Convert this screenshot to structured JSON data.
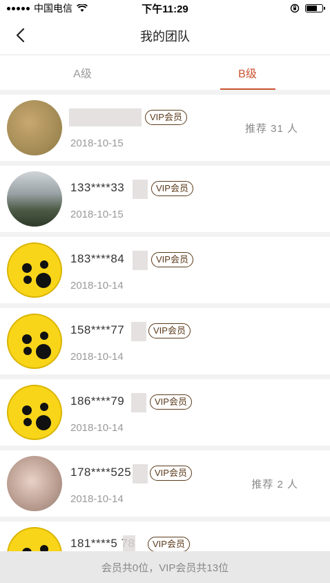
{
  "status_bar": {
    "carrier": "中国电信",
    "time": "下午11:29",
    "battery_level": 0.7
  },
  "nav": {
    "title": "我的团队",
    "back_icon": "chevron-left-icon"
  },
  "tabs": [
    {
      "label": "A级",
      "active": false
    },
    {
      "label": "B级",
      "active": true
    }
  ],
  "members": [
    {
      "phone": "",
      "badge": "VIP会员",
      "date": "2018-10-15",
      "recommend": "推荐 31 人",
      "avatar": "photo1"
    },
    {
      "phone": "133****33",
      "badge": "VIP会员",
      "date": "2018-10-15",
      "recommend": "",
      "avatar": "photo2"
    },
    {
      "phone": "183****84",
      "badge": "VIP会员",
      "date": "2018-10-14",
      "recommend": "",
      "avatar": "yellow"
    },
    {
      "phone": "158****77",
      "badge": "VIP会员",
      "date": "2018-10-14",
      "recommend": "",
      "avatar": "yellow"
    },
    {
      "phone": "186****79",
      "badge": "VIP会员",
      "date": "2018-10-14",
      "recommend": "",
      "avatar": "yellow"
    },
    {
      "phone": "178****525",
      "badge": "VIP会员",
      "date": "2018-10-14",
      "recommend": "推荐 2 人",
      "avatar": "photo3"
    },
    {
      "phone": "181****5 78",
      "badge": "VIP会员",
      "date": "",
      "recommend": "",
      "avatar": "yellow"
    }
  ],
  "footer": {
    "summary": "会员共0位，VIP会员共13位"
  }
}
